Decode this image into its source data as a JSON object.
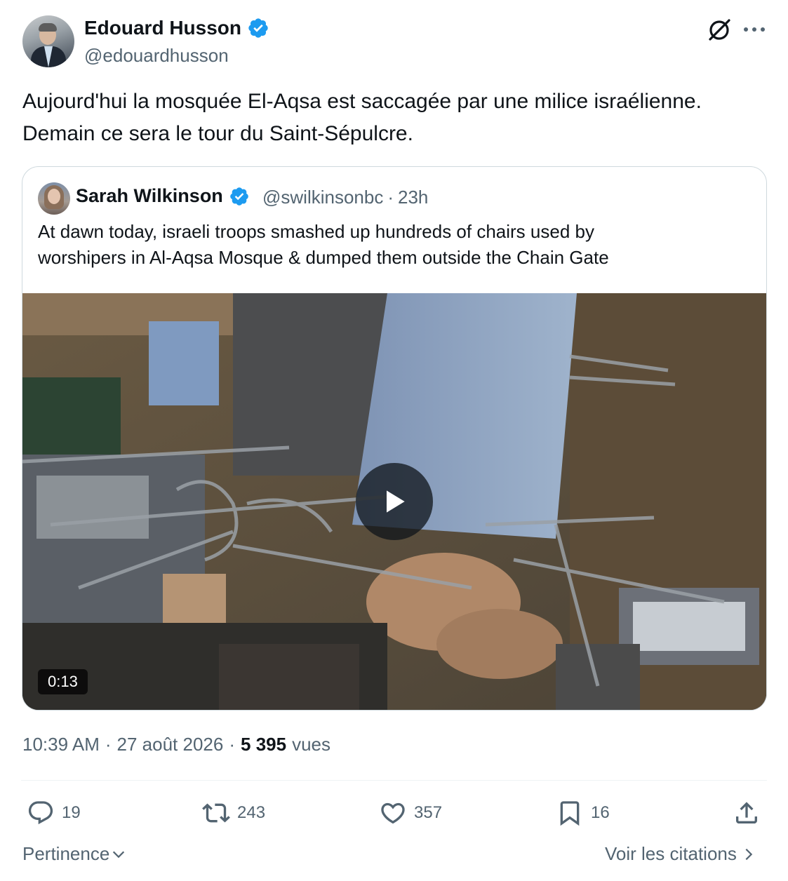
{
  "author": {
    "name": "Edouard Husson",
    "handle": "@edouardhusson"
  },
  "tweet": {
    "line1": "Aujourd'hui la mosquée El-Aqsa est saccagée par une milice israélienne.",
    "line2": "Demain ce sera le tour du Saint-Sépulcre."
  },
  "quoted": {
    "name": "Sarah Wilkinson",
    "handle": "@swilkinsonbc",
    "separator": "·",
    "time": "23h",
    "line1": "At dawn today, israeli troops smashed up hundreds of chairs used by",
    "line2": "worshipers in Al-Aqsa Mosque & dumped them outside the Chain Gate",
    "video_duration": "0:13"
  },
  "meta": {
    "time": "10:39 AM",
    "sep1": "·",
    "date": "27 août 2026",
    "sep2": "·",
    "views_count": "5 395",
    "views_label": "vues"
  },
  "actions": {
    "replies": "19",
    "reposts": "243",
    "likes": "357",
    "bookmarks": "16"
  },
  "footer": {
    "sort_label": "Pertinence",
    "quotes_link": "Voir les citations"
  },
  "colors": {
    "verified": "#1d9bf0",
    "secondary_text": "#536471",
    "primary_text": "#0f1419"
  },
  "icons": [
    "verified-badge-icon",
    "grok-icon",
    "more-icon",
    "play-icon",
    "reply-icon",
    "repost-icon",
    "like-icon",
    "bookmark-icon",
    "share-icon",
    "chevron-down-icon",
    "chevron-right-icon"
  ]
}
